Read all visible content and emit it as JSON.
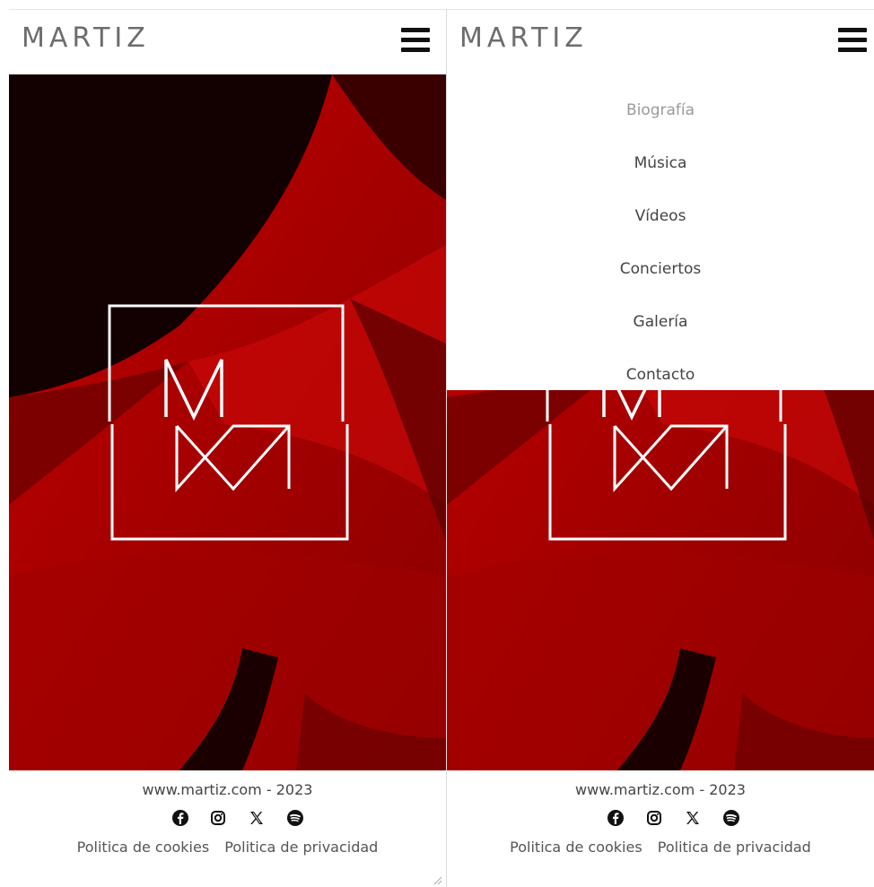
{
  "brand": {
    "logo_text": "MARTIZ"
  },
  "menu": {
    "items": [
      {
        "label": "Biografía",
        "active": true
      },
      {
        "label": "Música",
        "active": false
      },
      {
        "label": "Vídeos",
        "active": false
      },
      {
        "label": "Conciertos",
        "active": false
      },
      {
        "label": "Galería",
        "active": false
      },
      {
        "label": "Contacto",
        "active": false
      }
    ]
  },
  "footer": {
    "copyright": "www.martiz.com - 2023",
    "social_icons": [
      "facebook-icon",
      "instagram-icon",
      "x-icon",
      "spotify-icon"
    ],
    "cookies_label": "Politica de cookies",
    "privacy_label": "Politica de privacidad"
  },
  "colors": {
    "hero_red": "#b30000",
    "hero_dark": "#1a0000",
    "text": "#444444",
    "menu_active": "#9a9a9a"
  }
}
